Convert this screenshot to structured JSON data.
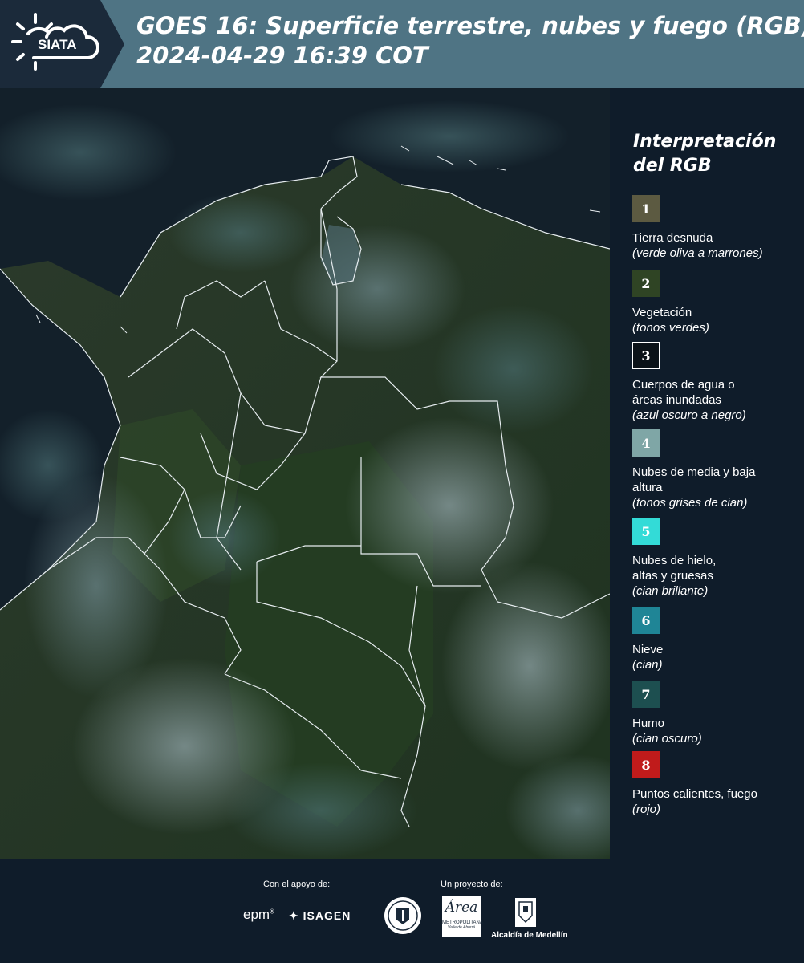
{
  "header": {
    "logo_text": "SIATA",
    "title_line1": "GOES 16: Superficie terrestre, nubes y fuego (RGB)",
    "title_line2": " 2024-04-29 16:39 COT"
  },
  "map": {
    "description_icon": "satellite-rgb-image",
    "boundary_color": "#e6ecef"
  },
  "legend": {
    "title_line1": "Interpretación",
    "title_line2": "del RGB",
    "items": [
      {
        "number": "1",
        "color": "#5c5a41",
        "label": "Tierra desnuda",
        "sub": "(verde oliva a marrones)"
      },
      {
        "number": "2",
        "color": "#2f4424",
        "label": "Vegetación",
        "sub": "(tonos verdes)"
      },
      {
        "number": "3",
        "color": "#0b1218",
        "label": "Cuerpos de agua o áreas inundadas",
        "sub": "(azul oscuro a negro)"
      },
      {
        "number": "4",
        "color": "#7fa6a6",
        "label": "Nubes de media y baja altura",
        "sub": "(tonos grises de cian)"
      },
      {
        "number": "5",
        "color": "#33dbd7",
        "label": "Nubes de hielo, altas y gruesas",
        "sub": "(cian brillante)"
      },
      {
        "number": "6",
        "color": "#1f8596",
        "label": "Nieve",
        "sub": "(cian)"
      },
      {
        "number": "7",
        "color": "#1d4f50",
        "label": "Humo",
        "sub": "(cian oscuro)"
      },
      {
        "number": "8",
        "color": "#c01b1b",
        "label": "Puntos calientes, fuego",
        "sub": "(rojo)"
      }
    ]
  },
  "footer": {
    "support_label": "Con el apoyo de:",
    "project_label": "Un proyecto de:",
    "epm": "epm",
    "isagen": "ISAGEN",
    "area_word": "Área",
    "area_sub": "METROPOLITANA",
    "area_sub2": "Valle de Aburrá",
    "alcaldia": "Alcaldía de Medellín"
  }
}
